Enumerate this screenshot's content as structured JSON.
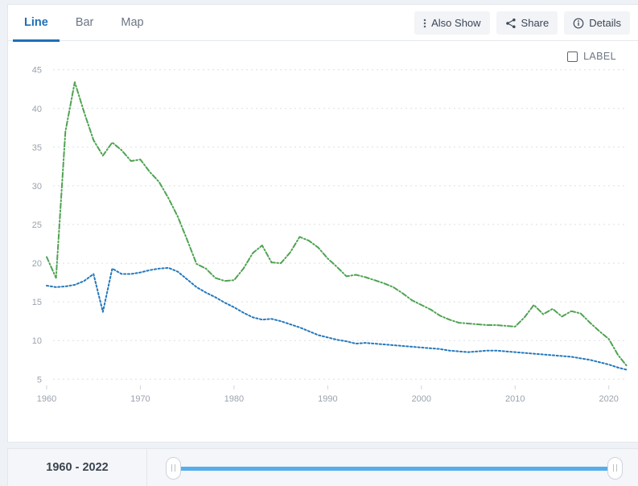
{
  "tabs": [
    {
      "label": "Line",
      "active": true
    },
    {
      "label": "Bar",
      "active": false
    },
    {
      "label": "Map",
      "active": false
    }
  ],
  "toolbar": {
    "also_show_label": "Also Show",
    "share_label": "Share",
    "details_label": "Details"
  },
  "legend": {
    "label": "LABEL",
    "checked": false
  },
  "timeline": {
    "range_label": "1960 - 2022",
    "start": 1960,
    "end": 2022
  },
  "colors": {
    "series_green": "#4fa352",
    "series_blue": "#2478bd",
    "accent": "#1d6fb8",
    "slider_track": "#57aee8",
    "grid": "#dcdfe3",
    "tick_text": "#9aa3ad"
  },
  "chart_data": {
    "type": "line",
    "title": "",
    "xlabel": "",
    "ylabel": "",
    "xlim": [
      1960,
      2022
    ],
    "ylim": [
      4.2,
      45.8
    ],
    "yticks": [
      5,
      10,
      15,
      20,
      25,
      30,
      35,
      40,
      45
    ],
    "xticks": [
      1960,
      1970,
      1980,
      1990,
      2000,
      2010,
      2020
    ],
    "grid": true,
    "legend_position": "top-right",
    "x": [
      1960,
      1961,
      1962,
      1963,
      1964,
      1965,
      1966,
      1967,
      1968,
      1969,
      1970,
      1971,
      1972,
      1973,
      1974,
      1975,
      1976,
      1977,
      1978,
      1979,
      1980,
      1981,
      1982,
      1983,
      1984,
      1985,
      1986,
      1987,
      1988,
      1989,
      1990,
      1991,
      1992,
      1993,
      1994,
      1995,
      1996,
      1997,
      1998,
      1999,
      2000,
      2001,
      2002,
      2003,
      2004,
      2005,
      2006,
      2007,
      2008,
      2009,
      2010,
      2011,
      2012,
      2013,
      2014,
      2015,
      2016,
      2017,
      2018,
      2019,
      2020,
      2021,
      2022
    ],
    "series": [
      {
        "name": "series-green",
        "color": "#4fa352",
        "style": "dash-dot",
        "values": [
          20.8,
          18.1,
          37.0,
          43.4,
          39.5,
          35.9,
          33.9,
          35.6,
          34.6,
          33.2,
          33.4,
          31.8,
          30.5,
          28.4,
          26.0,
          23.0,
          19.9,
          19.3,
          18.1,
          17.7,
          17.8,
          19.3,
          21.3,
          22.3,
          20.1,
          20.0,
          21.4,
          23.4,
          22.9,
          22.0,
          20.6,
          19.5,
          18.3,
          18.5,
          18.2,
          17.8,
          17.4,
          16.9,
          16.1,
          15.2,
          14.6,
          14.0,
          13.2,
          12.7,
          12.3,
          12.2,
          12.1,
          12.0,
          12.0,
          11.9,
          11.8,
          13.0,
          14.6,
          13.4,
          14.1,
          13.1,
          13.8,
          13.5,
          12.3,
          11.2,
          10.2,
          8.1,
          6.6
        ]
      },
      {
        "name": "series-blue",
        "color": "#2478bd",
        "style": "dotted",
        "values": [
          17.1,
          16.9,
          17.0,
          17.2,
          17.7,
          18.6,
          13.7,
          19.3,
          18.6,
          18.6,
          18.8,
          19.1,
          19.3,
          19.4,
          18.9,
          17.9,
          16.9,
          16.2,
          15.6,
          14.9,
          14.3,
          13.6,
          13.0,
          12.7,
          12.8,
          12.5,
          12.1,
          11.7,
          11.2,
          10.7,
          10.4,
          10.1,
          9.9,
          9.6,
          9.7,
          9.6,
          9.5,
          9.4,
          9.3,
          9.2,
          9.1,
          9.0,
          8.9,
          8.7,
          8.6,
          8.5,
          8.6,
          8.7,
          8.7,
          8.6,
          8.5,
          8.4,
          8.3,
          8.2,
          8.1,
          8.0,
          7.9,
          7.7,
          7.5,
          7.2,
          6.9,
          6.5,
          6.2
        ]
      }
    ]
  }
}
